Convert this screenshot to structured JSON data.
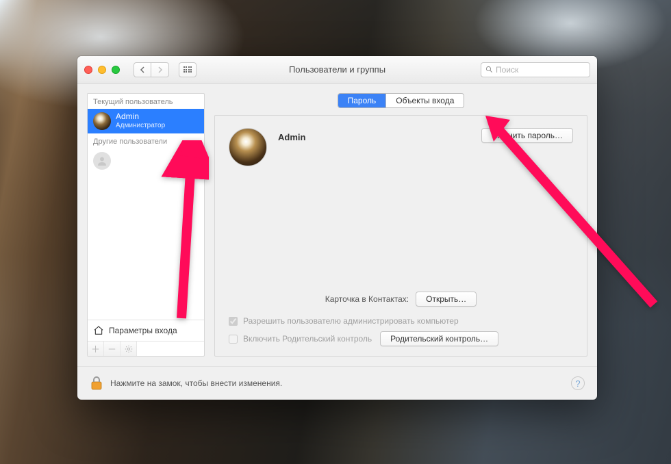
{
  "window": {
    "title": "Пользователи и группы",
    "search_placeholder": "Поиск"
  },
  "sidebar": {
    "current_user_label": "Текущий пользователь",
    "other_users_label": "Другие пользователи",
    "current_user": {
      "name": "Admin",
      "role": "Администратор"
    },
    "login_options_label": "Параметры входа"
  },
  "tabs": {
    "password": "Пароль",
    "login_items": "Объекты входа"
  },
  "main": {
    "user_name": "Admin",
    "change_password_btn": "Сменить пароль…",
    "contacts_label": "Карточка в Контактах:",
    "open_btn": "Открыть…",
    "allow_admin_label": "Разрешить пользователю администрировать компьютер",
    "parental_enable_label": "Включить Родительский контроль",
    "parental_open_btn": "Родительский контроль…"
  },
  "footer": {
    "lock_hint": "Нажмите на замок, чтобы внести изменения."
  },
  "colors": {
    "accent": "#3b82f6",
    "arrow": "#ff0b59"
  }
}
